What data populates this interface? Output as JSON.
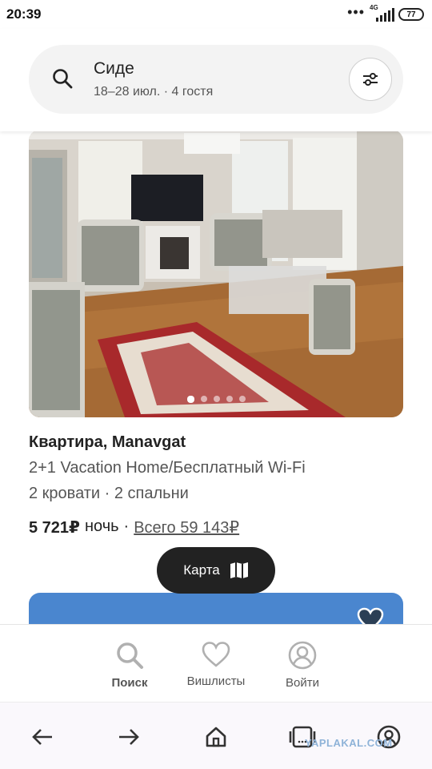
{
  "status": {
    "time": "20:39",
    "more": "•••",
    "network": "4G",
    "battery": "77"
  },
  "search": {
    "location": "Сиде",
    "details": "18–28 июл. · 4 гостя",
    "icon": "search-icon",
    "filter_icon": "filter-sliders-icon"
  },
  "listing": {
    "type_location": "Квартира, Manavgat",
    "name": "2+1 Vacation Home/Бесплатный Wi-Fi",
    "beds": "2 кровати · 2 спальни",
    "price": "5 721₽",
    "per": "ночь",
    "separator": "·",
    "total": "Всего 59 143₽",
    "photo_count": 5,
    "photo_index": 1
  },
  "map_button": {
    "label": "Карта",
    "icon": "map-icon"
  },
  "tab_bar": {
    "items": [
      {
        "label": "Поиск",
        "icon": "search-icon",
        "active": true
      },
      {
        "label": "Вишлисты",
        "icon": "heart-icon",
        "active": false
      },
      {
        "label": "Войти",
        "icon": "user-circle-icon",
        "active": false
      }
    ]
  },
  "browser_bar": {
    "icons": [
      "back-arrow-icon",
      "forward-arrow-icon",
      "home-icon",
      "tabs-icon",
      "profile-icon"
    ]
  },
  "watermark": "YAPLAKAL.COM",
  "colors": {
    "accent_dark": "#222222",
    "next_card": "#4a86cf",
    "muted_text": "#555555"
  }
}
